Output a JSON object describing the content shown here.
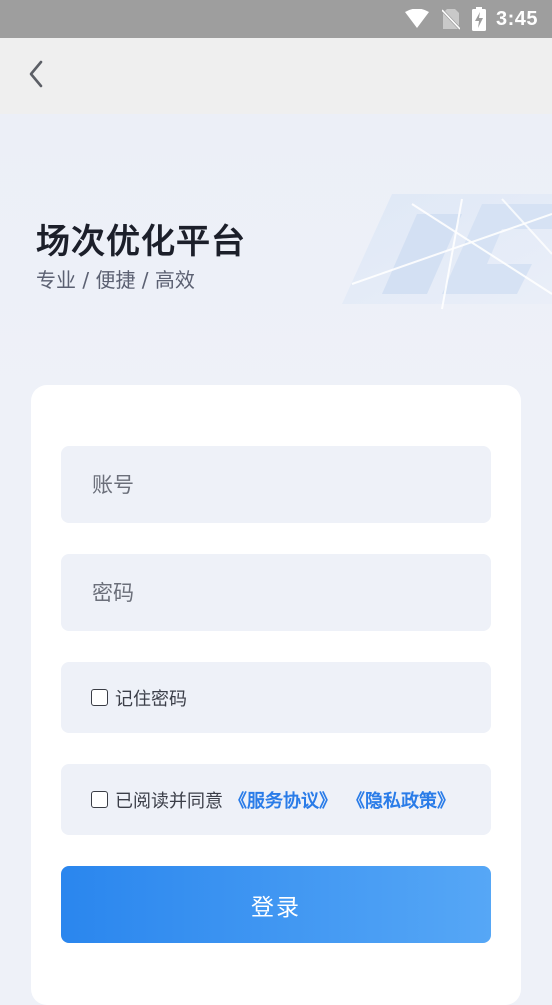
{
  "status_bar": {
    "time": "3:45",
    "icons": [
      "wifi-icon",
      "no-sim-icon",
      "battery-charging-icon"
    ]
  },
  "nav": {
    "back_icon": "chevron-left-icon"
  },
  "hero": {
    "title": "场次优化平台",
    "subtitle": "专业 / 便捷 / 高效"
  },
  "form": {
    "account_placeholder": "账号",
    "password_placeholder": "密码",
    "remember_label": "记住密码",
    "agree_label": "已阅读并同意",
    "service_link": "《服务协议》",
    "privacy_link": "《隐私政策》",
    "login_label": "登录"
  },
  "colors": {
    "accent": "#2a86ee",
    "link": "#2a7ce8",
    "page_bg": "#eef1f8",
    "status_bar": "#9e9e9e"
  }
}
